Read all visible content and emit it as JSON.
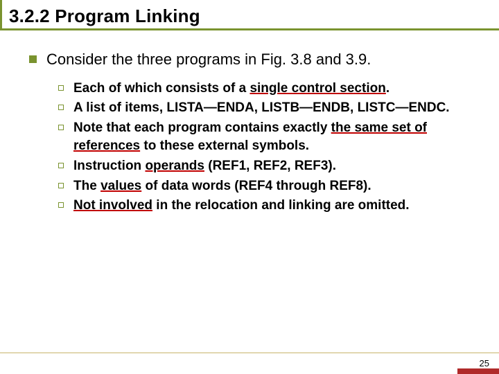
{
  "title": "3.2.2  Program Linking",
  "main_point": "Consider the three programs in Fig. 3.8 and 3.9.",
  "sub_points": [
    {
      "pre": "Each of which consists of a ",
      "u": "single control section",
      "post": "."
    },
    {
      "pre": "A list of items, LISTA—ENDA, LISTB—ENDB, LISTC—ENDC.",
      "u": "",
      "post": ""
    },
    {
      "pre": "Note that each program contains exactly ",
      "u": "the same set of references",
      "post": " to these external symbols."
    },
    {
      "pre": "Instruction ",
      "u": "operands",
      "post": " (REF1, REF2, REF3)."
    },
    {
      "pre": "The ",
      "u": "values",
      "post": " of data words (REF4 through REF8)."
    },
    {
      "pre": "",
      "u": "Not involved",
      "post": " in the relocation and linking are omitted."
    }
  ],
  "page_number": "25"
}
